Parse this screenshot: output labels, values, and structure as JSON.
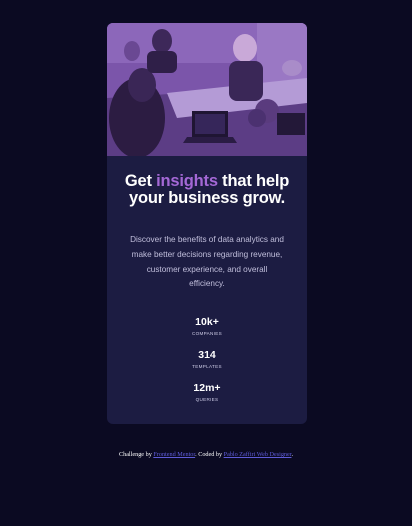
{
  "card": {
    "headline": {
      "before": "Get ",
      "accent": "insights",
      "after": " that help your business grow."
    },
    "description": "Discover the benefits of data analytics and make better decisions regarding revenue, customer experience, and overall efficiency.",
    "stats": [
      {
        "value": "10k+",
        "label": "COMPANIES"
      },
      {
        "value": "314",
        "label": "TEMPLATES"
      },
      {
        "value": "12m+",
        "label": "QUERIES"
      }
    ]
  },
  "footer": {
    "challenge_prefix": "Challenge by ",
    "challenge_link": "Frontend Mentor",
    "coded_prefix": ". Coded by ",
    "coded_link": "Pablo Zaffiri Web Designer",
    "suffix": "."
  },
  "colors": {
    "page_background": "#0b0a22",
    "card_background": "#1c1c42",
    "accent": "#a468d6",
    "image_overlay": "#6e4a9b",
    "link": "#5e5cd8"
  }
}
